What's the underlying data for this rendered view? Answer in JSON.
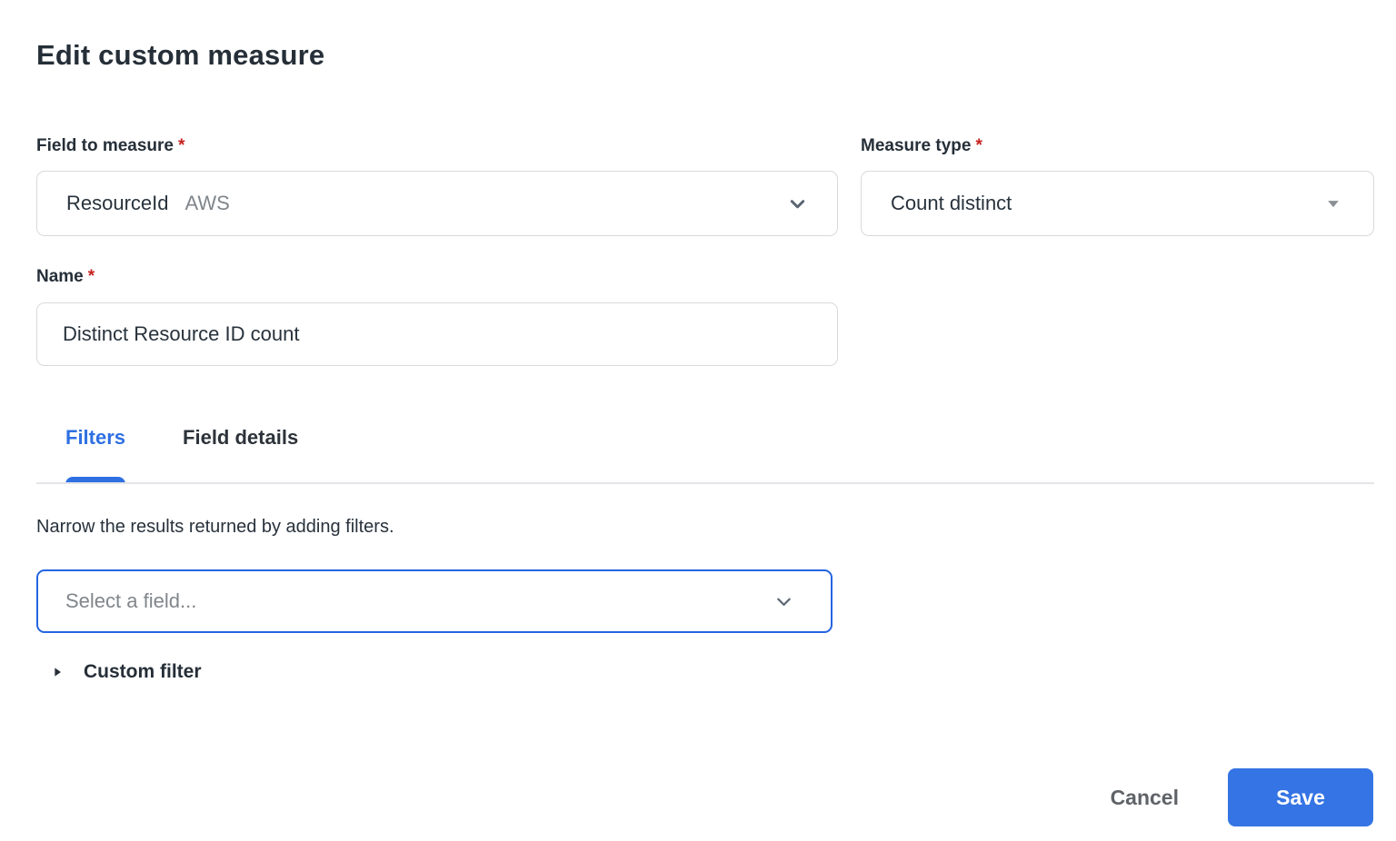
{
  "title": "Edit custom measure",
  "colors": {
    "accent_blue": "#2e70e2",
    "select_border_blue": "#2465e0",
    "save_button_blue": "#3574e4",
    "required_red": "#c5221f",
    "text_dark": "#28323c",
    "muted_gray": "#80868b",
    "border_gray": "#d7dadd"
  },
  "form": {
    "field_to_measure": {
      "label": "Field to measure",
      "required_mark": "*",
      "value": "ResourceId",
      "value_badge": "AWS"
    },
    "measure_type": {
      "label": "Measure type",
      "required_mark": "*",
      "value": "Count distinct"
    },
    "name": {
      "label": "Name",
      "required_mark": "*",
      "value": "Distinct Resource ID count"
    }
  },
  "tabs": [
    {
      "label": "Filters",
      "active": true
    },
    {
      "label": "Field details",
      "active": false
    }
  ],
  "filters_panel": {
    "description": "Narrow the results returned by adding filters.",
    "field_select": {
      "placeholder": "Select a field..."
    },
    "custom_filter": {
      "label": "Custom filter"
    }
  },
  "footer": {
    "cancel_label": "Cancel",
    "save_label": "Save"
  }
}
